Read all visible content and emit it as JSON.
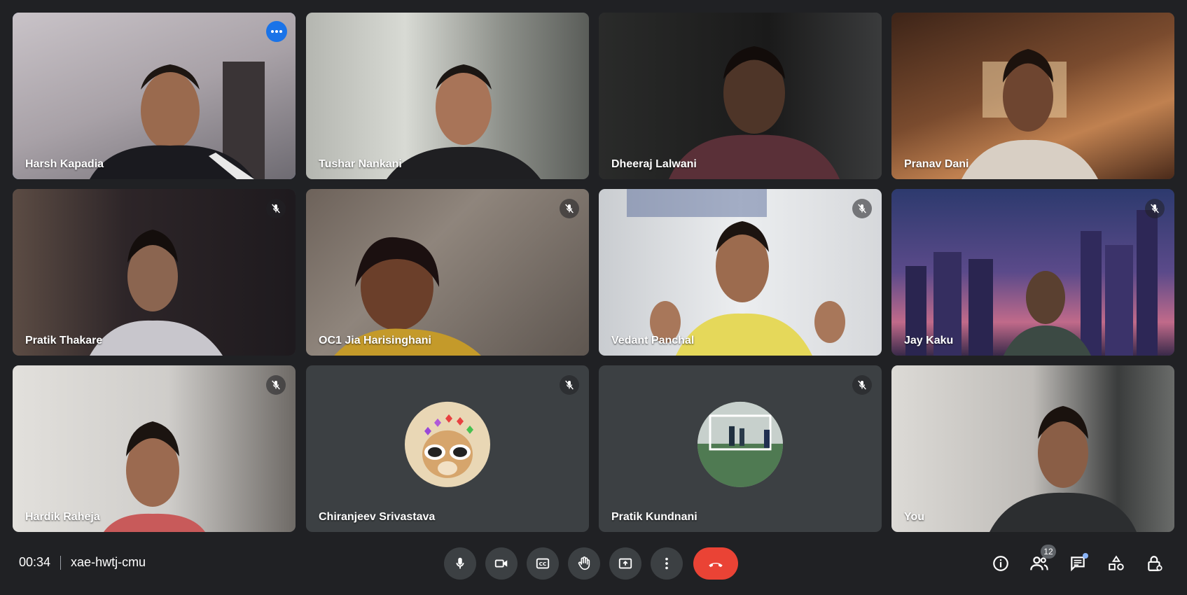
{
  "meeting": {
    "time": "00:34",
    "code": "xae-hwtj-cmu"
  },
  "participants": [
    {
      "name": "Harsh Kapadia",
      "muted": false,
      "active": true
    },
    {
      "name": "Tushar Nankani",
      "muted": false
    },
    {
      "name": "Dheeraj Lalwani",
      "muted": false
    },
    {
      "name": "Pranav Dani",
      "muted": false
    },
    {
      "name": "Pratik Thakare",
      "muted": true
    },
    {
      "name": "OC1 Jia Harisinghani",
      "muted": true
    },
    {
      "name": "Vedant Panchal",
      "muted": true
    },
    {
      "name": "Jay Kaku",
      "muted": true
    },
    {
      "name": "Hardik Raheja",
      "muted": true
    },
    {
      "name": "Chiranjeev Srivastava",
      "muted": true,
      "avatar": "dog-with-sunglasses"
    },
    {
      "name": "Pratik Kundnani",
      "muted": true,
      "avatar": "football-goal-photo"
    },
    {
      "name": "You",
      "muted": false
    }
  ],
  "controls": {
    "center": [
      "microphone-icon",
      "camera-icon",
      "captions-icon",
      "raise-hand-icon",
      "present-screen-icon",
      "more-options-icon",
      "end-call-icon"
    ],
    "right": [
      "info-icon",
      "people-icon",
      "chat-icon",
      "activities-icon",
      "host-controls-icon"
    ],
    "people_count": "12"
  },
  "colors": {
    "background": "#202124",
    "tile": "#3c4043",
    "end_call": "#ea4335",
    "active_border": "#8ab4f8"
  }
}
